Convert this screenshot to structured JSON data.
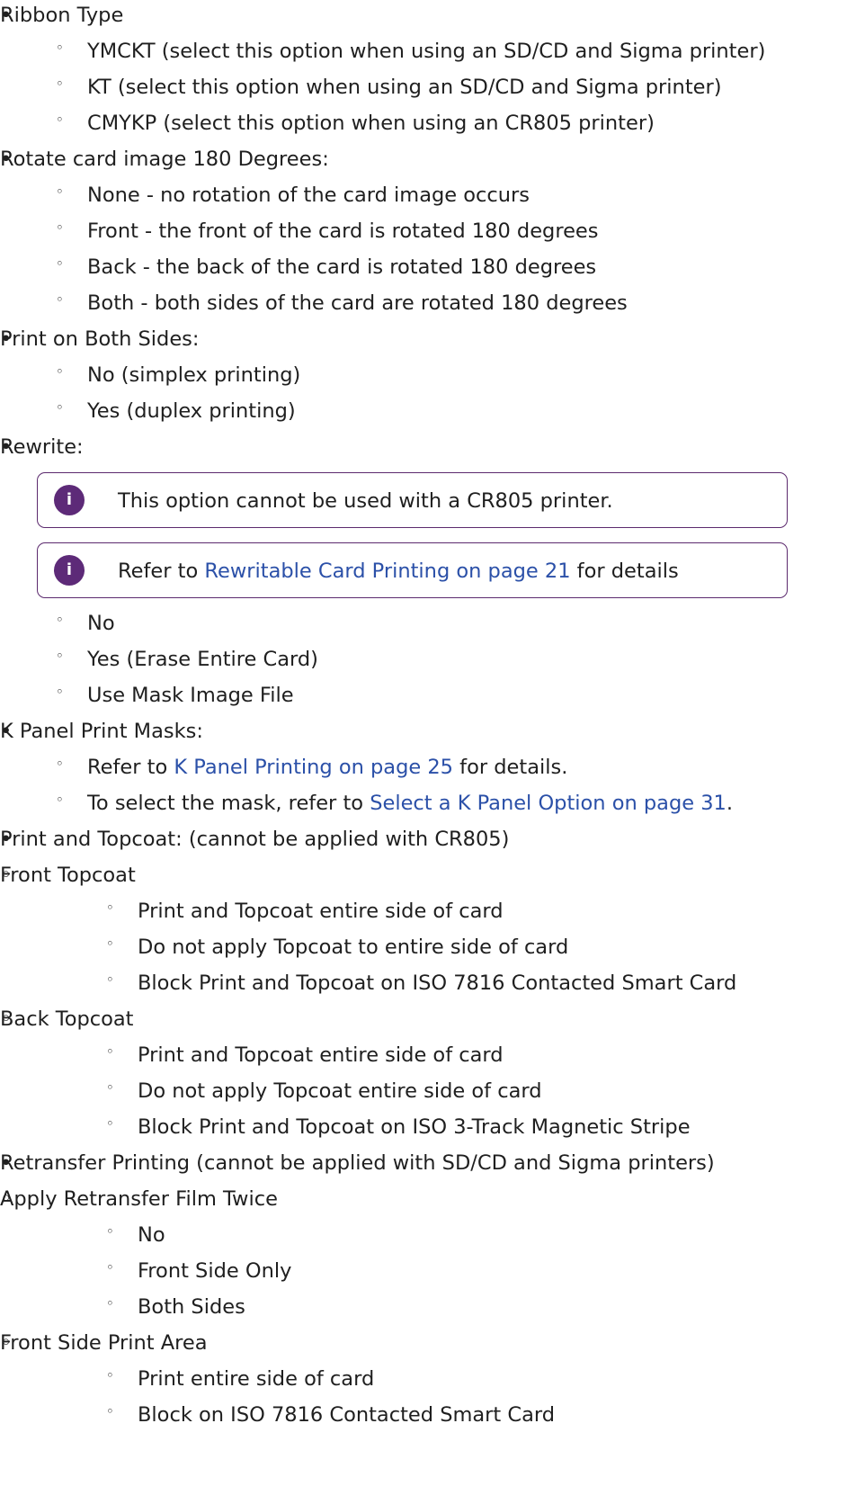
{
  "bullets": {
    "level1": "•",
    "level2": "◦",
    "level3": "◦"
  },
  "info_icon": "i",
  "sections": {
    "ribbon": {
      "title": "Ribbon Type",
      "items": [
        "YMCKT (select this option when using an SD/CD and Sigma printer)",
        "KT (select this option when using an SD/CD and Sigma printer)",
        "CMYKP (select this option when using an CR805 printer)"
      ]
    },
    "rotate": {
      "title": "Rotate card image 180 Degrees:",
      "items": [
        "None - no rotation of the card image occurs",
        "Front - the front of the card is rotated 180 degrees",
        "Back - the back of the card is rotated 180 degrees",
        "Both - both sides of the card are rotated 180 degrees"
      ]
    },
    "both_sides": {
      "title": "Print on Both Sides:",
      "items": [
        "No (simplex printing)",
        "Yes (duplex printing)"
      ]
    },
    "rewrite": {
      "title": "Rewrite:",
      "note1": "This option cannot be used with a CR805 printer.",
      "note2": {
        "before": "Refer to ",
        "link": "Rewritable Card Printing on page 21",
        "after": " for details"
      },
      "items": [
        "No",
        "Yes (Erase Entire Card)",
        "Use Mask Image File"
      ]
    },
    "kpanel": {
      "title": "K Panel Print Masks:",
      "item1": {
        "before": "Refer to ",
        "link": "K Panel Printing on page 25",
        "after": " for details."
      },
      "item2": {
        "before": "To select the mask, refer to ",
        "link": "Select a K Panel Option on page 31",
        "after": "."
      }
    },
    "topcoat": {
      "title": "Print and Topcoat: (cannot be applied with CR805)",
      "front": {
        "title": "Front Topcoat",
        "items": [
          "Print and Topcoat entire side of card",
          "Do not apply Topcoat to entire side of card",
          "Block Print and Topcoat on ISO 7816 Contacted Smart Card"
        ]
      },
      "back": {
        "title": "Back Topcoat",
        "items": [
          "Print and Topcoat entire side of card",
          "Do not apply Topcoat entire side of card",
          "Block Print and Topcoat on ISO 3-Track Magnetic Stripe"
        ]
      }
    },
    "retransfer": {
      "title": "Retransfer Printing (cannot be applied with SD/CD and Sigma printers)",
      "twice": {
        "title": "Apply Retransfer Film Twice",
        "items": [
          "No",
          "Front Side Only",
          "Both Sides"
        ]
      },
      "front_area": {
        "title": "Front Side Print Area",
        "items": [
          "Print entire side of card",
          "Block on ISO 7816 Contacted Smart Card"
        ]
      }
    }
  }
}
